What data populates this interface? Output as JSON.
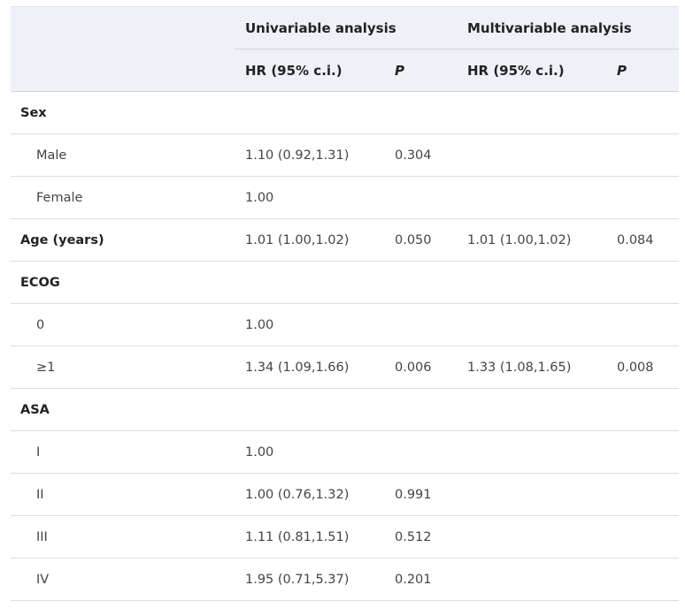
{
  "header": {
    "univariable_label": "Univariable analysis",
    "multivariable_label": "Multivariable analysis",
    "hr_label": "HR (95% c.i.)",
    "p_label": "P"
  },
  "rows": [
    {
      "label": "Sex",
      "kind": "category",
      "uni_hr": "",
      "uni_p": "",
      "multi_hr": "",
      "multi_p": ""
    },
    {
      "label": "Male",
      "kind": "sub",
      "uni_hr": "1.10 (0.92,1.31)",
      "uni_p": "0.304",
      "multi_hr": "",
      "multi_p": ""
    },
    {
      "label": "Female",
      "kind": "sub",
      "uni_hr": "1.00",
      "uni_p": "",
      "multi_hr": "",
      "multi_p": ""
    },
    {
      "label": "Age (years)",
      "kind": "category",
      "uni_hr": "1.01 (1.00,1.02)",
      "uni_p": "0.050",
      "multi_hr": "1.01 (1.00,1.02)",
      "multi_p": "0.084"
    },
    {
      "label": "ECOG",
      "kind": "category",
      "uni_hr": "",
      "uni_p": "",
      "multi_hr": "",
      "multi_p": ""
    },
    {
      "label": "0",
      "kind": "sub",
      "uni_hr": "1.00",
      "uni_p": "",
      "multi_hr": "",
      "multi_p": ""
    },
    {
      "label": "≥1",
      "kind": "sub",
      "uni_hr": "1.34 (1.09,1.66)",
      "uni_p": "0.006",
      "multi_hr": "1.33 (1.08,1.65)",
      "multi_p": "0.008"
    },
    {
      "label": "ASA",
      "kind": "category",
      "uni_hr": "",
      "uni_p": "",
      "multi_hr": "",
      "multi_p": ""
    },
    {
      "label": "I",
      "kind": "sub",
      "uni_hr": "1.00",
      "uni_p": "",
      "multi_hr": "",
      "multi_p": ""
    },
    {
      "label": "II",
      "kind": "sub",
      "uni_hr": "1.00 (0.76,1.32)",
      "uni_p": "0.991",
      "multi_hr": "",
      "multi_p": ""
    },
    {
      "label": "III",
      "kind": "sub",
      "uni_hr": "1.11 (0.81,1.51)",
      "uni_p": "0.512",
      "multi_hr": "",
      "multi_p": ""
    },
    {
      "label": "IV",
      "kind": "sub",
      "uni_hr": "1.95 (0.71,5.37)",
      "uni_p": "0.201",
      "multi_hr": "",
      "multi_p": ""
    }
  ]
}
